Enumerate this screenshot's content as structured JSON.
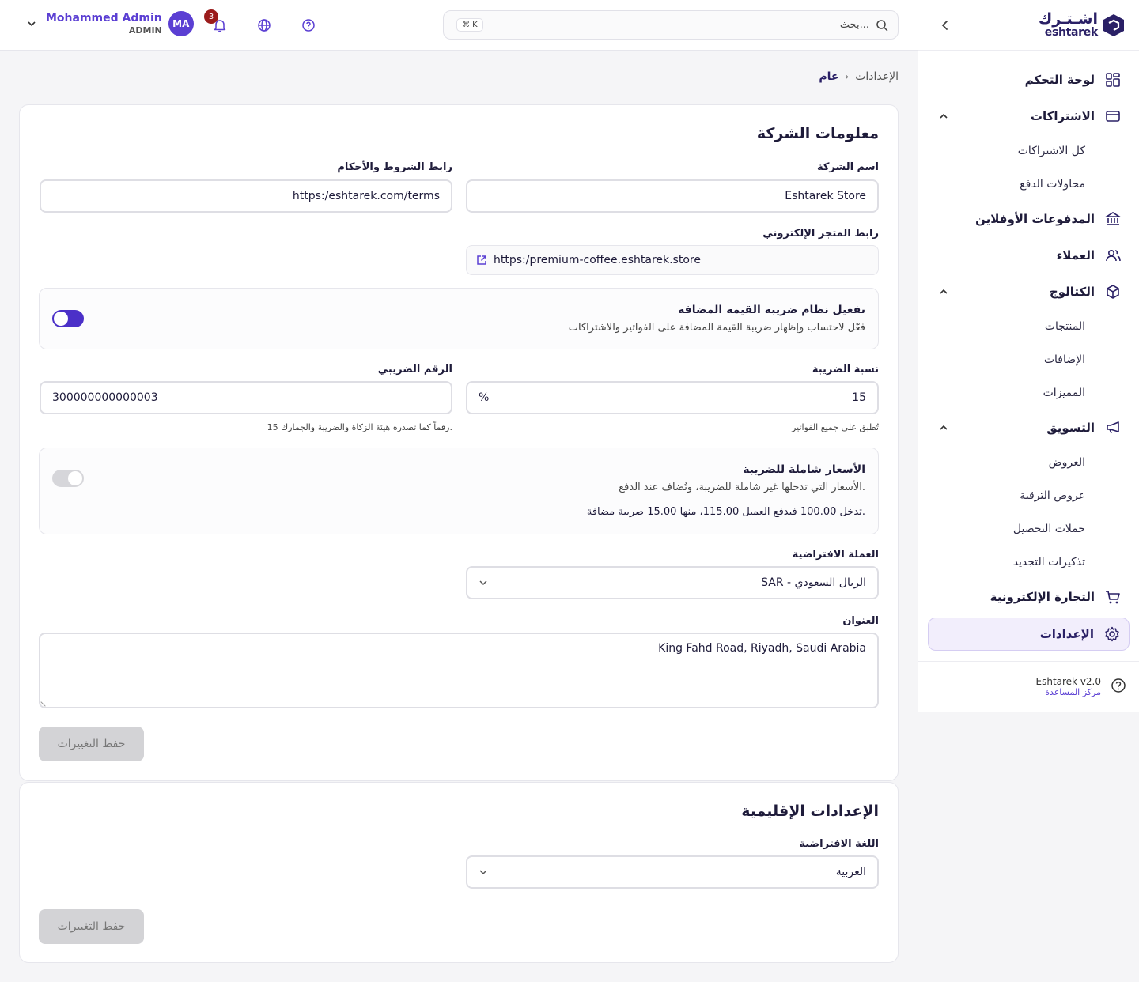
{
  "brand": {
    "name_ar": "اشـتـرك",
    "name_en": "eshtarek"
  },
  "sidebar": {
    "items": [
      {
        "label": "لوحة التحكم"
      },
      {
        "label": "الاشتراكات"
      },
      {
        "label": "كل الاشتراكات"
      },
      {
        "label": "محاولات الدفع"
      },
      {
        "label": "المدفوعات الأوفلاين"
      },
      {
        "label": "العملاء"
      },
      {
        "label": "الكتالوج"
      },
      {
        "label": "المنتجات"
      },
      {
        "label": "الإضافات"
      },
      {
        "label": "المميزات"
      },
      {
        "label": "التسويق"
      },
      {
        "label": "العروض"
      },
      {
        "label": "عروض الترقية"
      },
      {
        "label": "حملات التحصيل"
      },
      {
        "label": "تذكيرات التجديد"
      },
      {
        "label": "التجارة الإلكترونية"
      },
      {
        "label": "الإعدادات"
      }
    ],
    "footer": {
      "version": "Eshtarek v2.0",
      "help": "مركز المساعدة"
    }
  },
  "topbar": {
    "user_name": "Mohammed Admin",
    "user_role": "ADMIN",
    "avatar_initials": "MA",
    "notifications_count": "3",
    "search_placeholder": "بحث...",
    "search_shortcut": "⌘ K"
  },
  "breadcrumb": {
    "parent": "الإعدادات",
    "separator": "›",
    "current": "عام"
  },
  "company": {
    "title": "معلومات الشركة",
    "name_label": "اسم الشركة",
    "name_value": "Eshtarek Store",
    "terms_label": "رابط الشروط والأحكام",
    "terms_value": "https:/eshtarek.com/terms",
    "store_label": "رابط المتجر الإلكتروني",
    "store_value": "https:/premium-coffee.eshtarek.store",
    "vat_title": "تفعيل نظام ضريبة القيمة المضافة",
    "vat_desc": "فعّل لاحتساب وإظهار ضريبة القيمة المضافة على الفواتير والاشتراكات",
    "tax_rate_label": "نسبة الضريبة",
    "tax_rate_value": "15",
    "tax_rate_unit": "%",
    "tax_rate_hint": "تُطبق على جميع الفواتير",
    "tax_number_label": "الرقم الضريبي",
    "tax_number_value": "300000000000003",
    "tax_number_hint": "15 رقماً كما تصدره هيئة الزكاة والضريبة والجمارك.",
    "inclusive_title": "الأسعار شاملة للضريبة",
    "inclusive_desc": "الأسعار التي تدخلها غير شاملة للضريبة، وتُضاف عند الدفع.",
    "inclusive_example": "تدخل 100.00 فيدفع العميل 115.00، منها 15.00 ضريبة مضافة.",
    "currency_label": "العملة الافتراضية",
    "currency_value": "SAR - الريال السعودي",
    "address_label": "العنوان",
    "address_value": "King Fahd Road, Riyadh, Saudi Arabia",
    "save_label": "حفظ التغييرات"
  },
  "regional": {
    "title": "الإعدادات الإقليمية",
    "language_label": "اللغة الافتراضية",
    "language_value": "العربية",
    "save_label": "حفظ التغييرات"
  },
  "colors": {
    "accent": "#5b3fd3",
    "brand": "#2a2066",
    "badge": "#9b1c1c"
  }
}
